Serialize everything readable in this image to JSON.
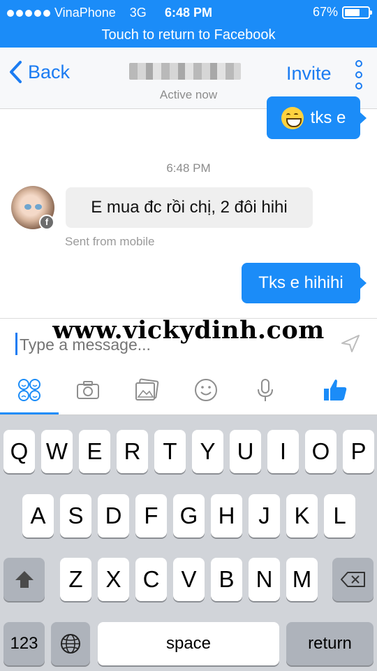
{
  "status_bar": {
    "carrier": "VinaPhone",
    "network": "3G",
    "time": "6:48 PM",
    "battery_percent": "67%",
    "battery_level": 0.67
  },
  "return_bar": {
    "label": "Touch to return to Facebook"
  },
  "nav": {
    "back_label": "Back",
    "contact_name": "",
    "status": "Active now",
    "invite_label": "Invite"
  },
  "messages": {
    "outgoing_1": {
      "text": "tks e",
      "emoji": "grinning-face"
    },
    "timestamp": "6:48 PM",
    "incoming_1": {
      "text": "E mua đc rồi chị, 2 đôi hihi"
    },
    "sent_from": "Sent from mobile",
    "outgoing_2": {
      "text": "Tks e hihihi"
    }
  },
  "composer": {
    "placeholder": "Type a message...",
    "watermark": "www.vickydinh.com"
  },
  "toolbar": {
    "icons": [
      "stickers-icon",
      "camera-icon",
      "photo-gallery-icon",
      "emoji-icon",
      "microphone-icon",
      "like-thumb-icon"
    ]
  },
  "keyboard": {
    "row1": [
      "Q",
      "W",
      "E",
      "R",
      "T",
      "Y",
      "U",
      "I",
      "O",
      "P"
    ],
    "row2": [
      "A",
      "S",
      "D",
      "F",
      "G",
      "H",
      "J",
      "K",
      "L"
    ],
    "row3": [
      "Z",
      "X",
      "C",
      "V",
      "B",
      "N",
      "M"
    ],
    "numbers_label": "123",
    "space_label": "space",
    "return_label": "return"
  },
  "colors": {
    "accent": "#1b8cf8",
    "link": "#1b7cf2",
    "incoming_bubble": "#efefef",
    "keyboard_bg": "#d1d4d9"
  }
}
